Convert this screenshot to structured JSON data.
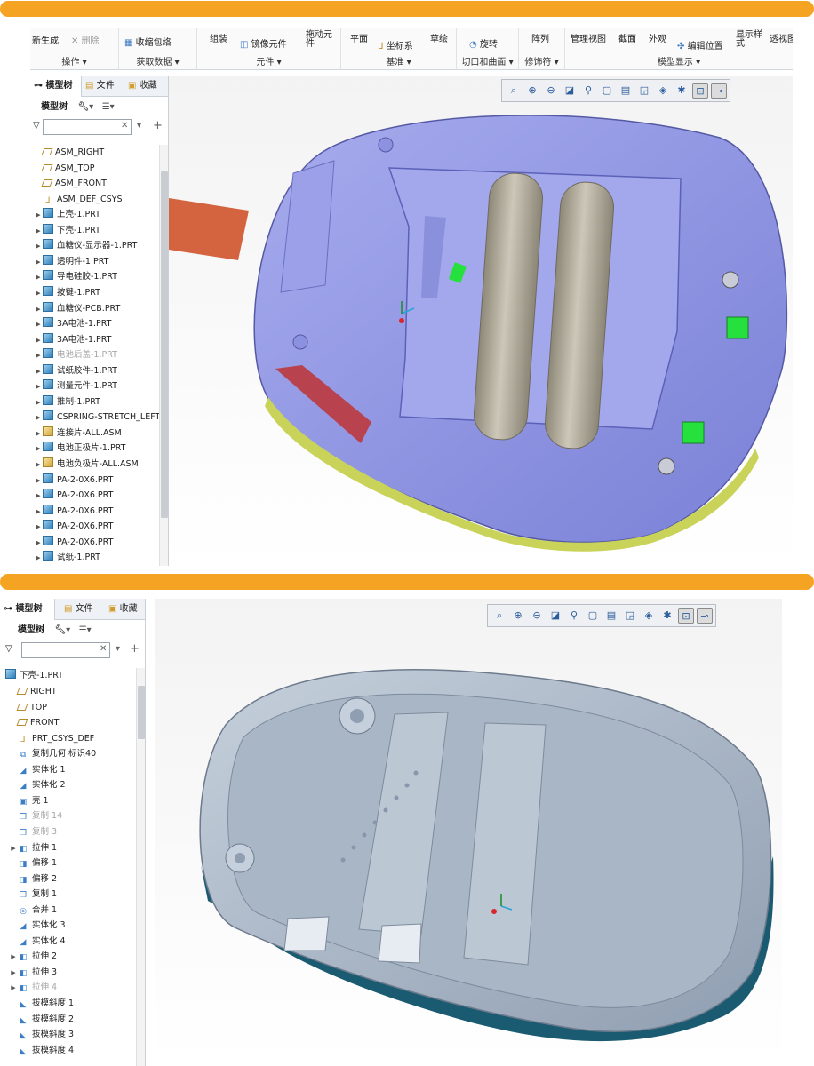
{
  "window1": {
    "ribbon": {
      "groups": [
        {
          "label": "操作",
          "items": [
            "新生成",
            "删除"
          ]
        },
        {
          "label": "获取数据",
          "items": [
            "收缩包络"
          ]
        },
        {
          "label": "元件",
          "items": [
            "组装",
            "镜像元件",
            "拖动元件"
          ]
        },
        {
          "label": "基准",
          "items": [
            "平面",
            "坐标系",
            "草绘"
          ]
        },
        {
          "label": "切口和曲面",
          "items": [
            "旋转"
          ]
        },
        {
          "label": "修饰符",
          "items": [
            "阵列"
          ]
        },
        {
          "label": "模型显示",
          "items": [
            "管理视图",
            "截面",
            "外观",
            "编辑位置",
            "显示样式",
            "透视图"
          ]
        }
      ]
    },
    "tabs": [
      "模型树",
      "文件",
      "收藏"
    ],
    "tree_toolbar_label": "模型树",
    "filter": {
      "value": "",
      "placeholder": ""
    },
    "tree_items": [
      {
        "label": "ASM_RIGHT",
        "icon": "datum-plane-icon",
        "expandable": false,
        "dim": false
      },
      {
        "label": "ASM_TOP",
        "icon": "datum-plane-icon",
        "expandable": false,
        "dim": false
      },
      {
        "label": "ASM_FRONT",
        "icon": "datum-plane-icon",
        "expandable": false,
        "dim": false
      },
      {
        "label": "ASM_DEF_CSYS",
        "icon": "csys-icon",
        "expandable": false,
        "dim": false
      },
      {
        "label": "上壳-1.PRT",
        "icon": "part-icon",
        "expandable": true,
        "dim": false
      },
      {
        "label": "下壳-1.PRT",
        "icon": "part-icon",
        "expandable": true,
        "dim": false
      },
      {
        "label": "血糖仪-显示器-1.PRT",
        "icon": "part-icon",
        "expandable": true,
        "dim": false
      },
      {
        "label": "透明件-1.PRT",
        "icon": "part-icon",
        "expandable": true,
        "dim": false
      },
      {
        "label": "导电硅胶-1.PRT",
        "icon": "part-icon",
        "expandable": true,
        "dim": false
      },
      {
        "label": "按键-1.PRT",
        "icon": "part-icon",
        "expandable": true,
        "dim": false
      },
      {
        "label": "血糖仪-PCB.PRT",
        "icon": "part-icon",
        "expandable": true,
        "dim": false
      },
      {
        "label": "3A电池-1.PRT",
        "icon": "part-icon",
        "expandable": true,
        "dim": false
      },
      {
        "label": "3A电池-1.PRT",
        "icon": "part-icon",
        "expandable": true,
        "dim": false
      },
      {
        "label": "电池后盖-1.PRT",
        "icon": "part-icon",
        "expandable": true,
        "dim": true
      },
      {
        "label": "试纸胶件-1.PRT",
        "icon": "part-icon",
        "expandable": true,
        "dim": false
      },
      {
        "label": "测量元件-1.PRT",
        "icon": "part-icon",
        "expandable": true,
        "dim": false
      },
      {
        "label": "推制-1.PRT",
        "icon": "part-icon",
        "expandable": true,
        "dim": false
      },
      {
        "label": "CSPRING-STRETCH_LEFT",
        "icon": "part-icon",
        "expandable": true,
        "dim": false
      },
      {
        "label": "连接片-ALL.ASM",
        "icon": "asm-icon",
        "expandable": true,
        "dim": false
      },
      {
        "label": "电池正极片-1.PRT",
        "icon": "part-icon",
        "expandable": true,
        "dim": false
      },
      {
        "label": "电池负极片-ALL.ASM",
        "icon": "asm-icon",
        "expandable": true,
        "dim": false
      },
      {
        "label": "PA-2-0X6.PRT",
        "icon": "part-icon",
        "expandable": true,
        "dim": false
      },
      {
        "label": "PA-2-0X6.PRT",
        "icon": "part-icon",
        "expandable": true,
        "dim": false
      },
      {
        "label": "PA-2-0X6.PRT",
        "icon": "part-icon",
        "expandable": true,
        "dim": false
      },
      {
        "label": "PA-2-0X6.PRT",
        "icon": "part-icon",
        "expandable": true,
        "dim": false
      },
      {
        "label": "PA-2-0X6.PRT",
        "icon": "part-icon",
        "expandable": true,
        "dim": false
      },
      {
        "label": "试纸-1.PRT",
        "icon": "part-icon",
        "expandable": true,
        "dim": false
      }
    ]
  },
  "window2": {
    "tabs": [
      "模型树",
      "文件",
      "收藏"
    ],
    "tree_toolbar_label": "模型树",
    "filter": {
      "value": "",
      "placeholder": ""
    },
    "root": "下壳-1.PRT",
    "tree_items": [
      {
        "label": "RIGHT",
        "icon": "datum-plane-icon",
        "expandable": false,
        "dim": false
      },
      {
        "label": "TOP",
        "icon": "datum-plane-icon",
        "expandable": false,
        "dim": false
      },
      {
        "label": "FRONT",
        "icon": "datum-plane-icon",
        "expandable": false,
        "dim": false
      },
      {
        "label": "PRT_CSYS_DEF",
        "icon": "csys-icon",
        "expandable": false,
        "dim": false
      },
      {
        "label": "复制几何 标识40",
        "icon": "copy-geometry-icon",
        "expandable": false,
        "dim": false
      },
      {
        "label": "实体化 1",
        "icon": "solidify-icon",
        "expandable": false,
        "dim": false
      },
      {
        "label": "实体化 2",
        "icon": "solidify-icon",
        "expandable": false,
        "dim": false
      },
      {
        "label": "壳 1",
        "icon": "shell-icon",
        "expandable": false,
        "dim": false
      },
      {
        "label": "复制 14",
        "icon": "copy-icon",
        "expandable": false,
        "dim": true
      },
      {
        "label": "复制 3",
        "icon": "copy-icon",
        "expandable": false,
        "dim": true
      },
      {
        "label": "拉伸 1",
        "icon": "extrude-icon",
        "expandable": true,
        "dim": false
      },
      {
        "label": "偏移 1",
        "icon": "offset-icon",
        "expandable": false,
        "dim": false
      },
      {
        "label": "偏移 2",
        "icon": "offset-icon",
        "expandable": false,
        "dim": false
      },
      {
        "label": "复制 1",
        "icon": "copy-icon",
        "expandable": false,
        "dim": false
      },
      {
        "label": "合并 1",
        "icon": "merge-icon",
        "expandable": false,
        "dim": false
      },
      {
        "label": "实体化 3",
        "icon": "solidify-icon",
        "expandable": false,
        "dim": false
      },
      {
        "label": "实体化 4",
        "icon": "solidify-icon",
        "expandable": false,
        "dim": false
      },
      {
        "label": "拉伸 2",
        "icon": "extrude-icon",
        "expandable": true,
        "dim": false
      },
      {
        "label": "拉伸 3",
        "icon": "extrude-icon",
        "expandable": true,
        "dim": false
      },
      {
        "label": "拉伸 4",
        "icon": "extrude-icon",
        "expandable": true,
        "dim": true
      },
      {
        "label": "拔模斜度 1",
        "icon": "draft-icon",
        "expandable": false,
        "dim": false
      },
      {
        "label": "拔模斜度 2",
        "icon": "draft-icon",
        "expandable": false,
        "dim": false
      },
      {
        "label": "拔模斜度 3",
        "icon": "draft-icon",
        "expandable": false,
        "dim": false
      },
      {
        "label": "拔模斜度 4",
        "icon": "draft-icon",
        "expandable": false,
        "dim": false
      }
    ]
  },
  "view_toolbar_icons": [
    "refit-icon",
    "zoom-in-icon",
    "zoom-out-icon",
    "repaint-icon",
    "saved-orientation-icon",
    "view-manager-icon",
    "display-style-icon",
    "section-icon",
    "appearance-icon",
    "datum-display-icon",
    "spin-center-icon",
    "annotation-display-icon"
  ],
  "colors": {
    "accent_bar": "#f5a323",
    "shell_blue": "#8c92e0",
    "battery": "#b9b3a6",
    "part_gray": "#a8b6c6",
    "part_teal": "#1a5b72"
  }
}
